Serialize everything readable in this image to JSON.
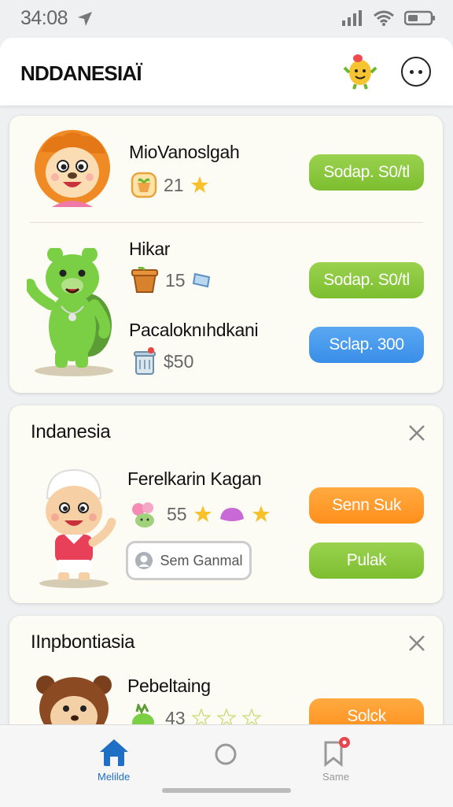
{
  "status_bar": {
    "time": "34:08"
  },
  "header": {
    "title": "NDDANESIAÏ"
  },
  "card1": {
    "items": [
      {
        "name": "MioVanoslgah",
        "count": "21",
        "button": "Sodap. S0/tl"
      },
      {
        "name": "Hikar",
        "count": "15",
        "button": "Sodap. S0/tl"
      },
      {
        "name": "Pacaloknıhdkani",
        "count": "$50",
        "button": "Sclap. 300"
      }
    ]
  },
  "card2": {
    "title": "Indanesia",
    "name": "Ferelkarin Kagan",
    "count": "55",
    "outline_button": "Sem Ganmal",
    "button_primary": "Senn Suk",
    "button_secondary": "Pulak"
  },
  "card3": {
    "title": "IInpbontiasia",
    "name": "Pebeltaing",
    "count": "43",
    "button": "Solck"
  },
  "tab_bar": {
    "tabs": [
      {
        "label": "Melilde"
      },
      {
        "label": ""
      },
      {
        "label": "Same"
      }
    ]
  },
  "colors": {
    "green_button": "#8cc83f",
    "blue_button": "#4a9cef",
    "orange_button": "#ff9a2e",
    "active_tab": "#1f6fc5"
  }
}
